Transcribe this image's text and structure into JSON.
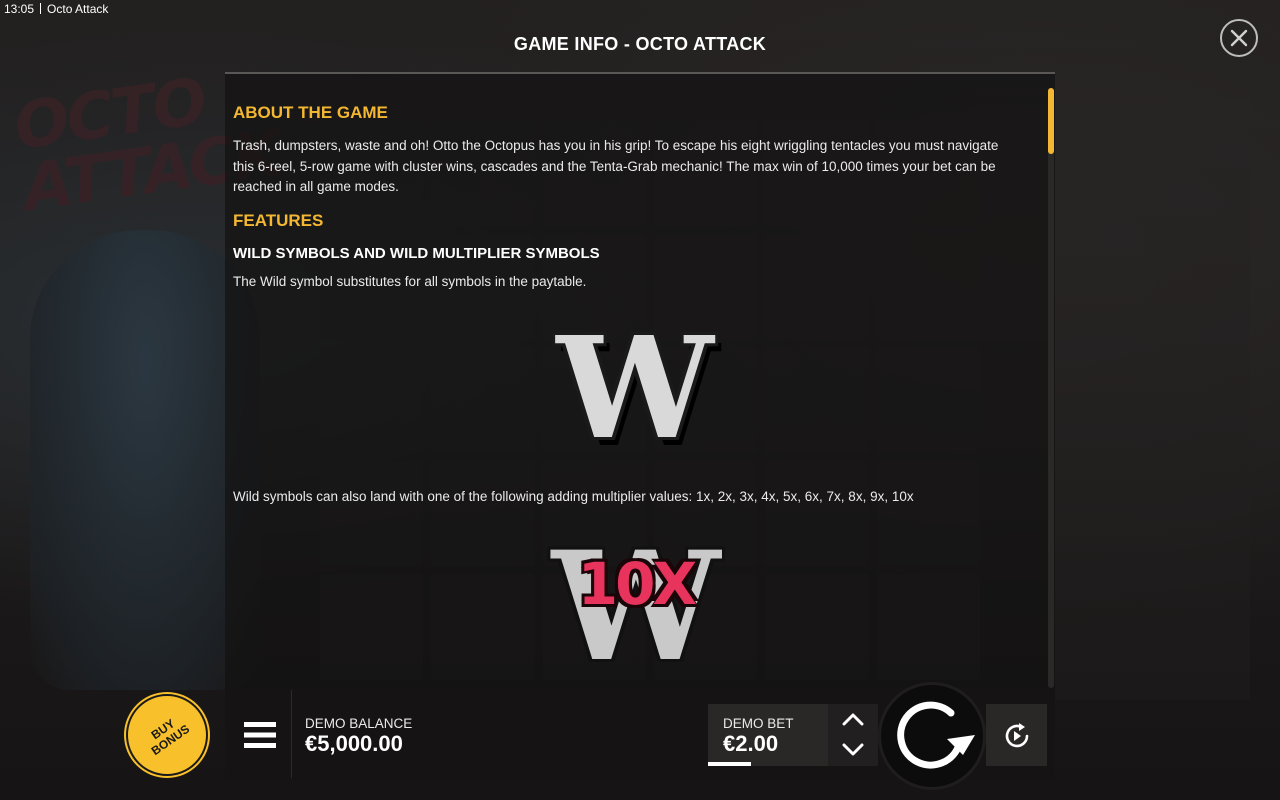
{
  "status_bar": {
    "time": "13:05",
    "app_name": "Octo Attack"
  },
  "info": {
    "title": "GAME INFO - OCTO ATTACK",
    "sections": {
      "about_heading": "ABOUT THE GAME",
      "about_text": "Trash, dumpsters, waste and oh! Otto the Octopus has you in his grip! To escape his eight wriggling tentacles you must navigate this 6-reel, 5-row game with cluster wins, cascades and the Tenta-Grab mechanic! The max win of 10,000 times your bet can be reached in all game modes.",
      "features_heading": "FEATURES",
      "wild_heading": "WILD SYMBOLS AND WILD MULTIPLIER SYMBOLS",
      "wild_text": "The Wild symbol substitutes for all symbols in the paytable.",
      "wild_multiplier_text": "Wild symbols can also land with one of the following adding multiplier values: 1x, 2x, 3x, 4x, 5x, 6x, 7x, 8x, 9x, 10x"
    },
    "wild_symbol_letter": "W",
    "wild_multiplier_value": "10X",
    "scroll_position": 0.0
  },
  "bottom_bar": {
    "balance_label": "DEMO BALANCE",
    "balance_value": "€5,000.00",
    "bet_label": "DEMO BET",
    "bet_value": "€2.00",
    "buy_bonus_line1": "BUY",
    "buy_bonus_line2": "BONUS"
  },
  "colors": {
    "accent": "#f4b731",
    "buy_bonus": "#f8c02b",
    "multiplier": "#e8345c",
    "panel_bg": "#141212"
  },
  "icons": {
    "close": "close-icon",
    "menu": "hamburger-menu-icon",
    "bet_up": "chevron-up-icon",
    "bet_down": "chevron-down-icon",
    "spin": "spin-arrow-icon",
    "autoplay": "autoplay-icon"
  }
}
